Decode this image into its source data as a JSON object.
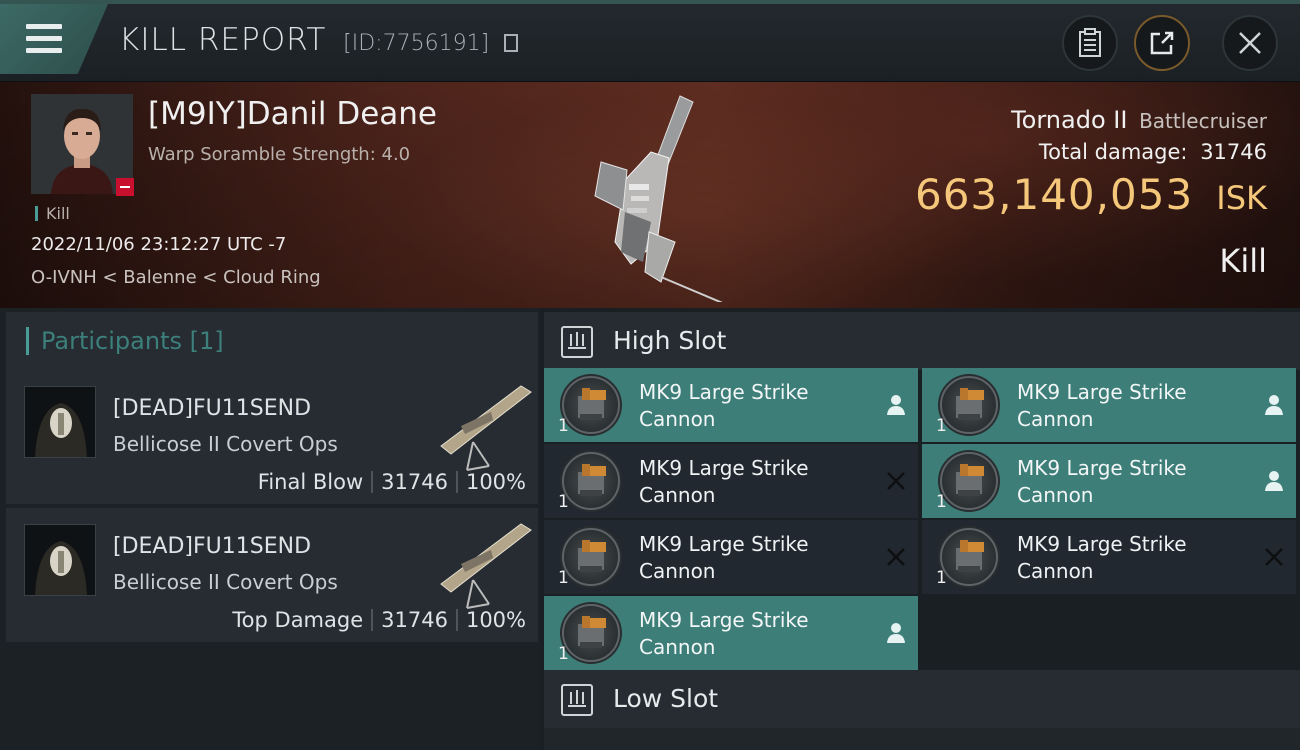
{
  "window": {
    "title": "KILL REPORT",
    "report_id": "[ID:7756191]"
  },
  "victim": {
    "name": "[M9IY]Danil Deane",
    "warp_scramble": "Warp Soramble Strength: 4.0",
    "tag": "Kill",
    "datetime": "2022/11/06 23:12:27 UTC -7",
    "location": "O-IVNH < Balenne < Cloud Ring"
  },
  "ship": {
    "name": "Tornado II",
    "class": "Battlecruiser",
    "total_damage_label": "Total damage:",
    "total_damage": "31746",
    "isk_value": "663,140,053",
    "isk_unit": "ISK",
    "result": "Kill"
  },
  "participants": {
    "title": "Participants [1]",
    "rows": [
      {
        "name": "[DEAD]FU11SEND",
        "ship": "Bellicose II Covert Ops",
        "role": "Final Blow",
        "damage": "31746",
        "percent": "100%"
      },
      {
        "name": "[DEAD]FU11SEND",
        "ship": "Bellicose II Covert Ops",
        "role": "Top Damage",
        "damage": "31746",
        "percent": "100%"
      }
    ]
  },
  "slots": {
    "high_title": "High Slot",
    "low_title": "Low Slot",
    "high_modules": [
      {
        "name": "MK9 Large Strike Cannon",
        "qty": "1",
        "state": "dropped"
      },
      {
        "name": "MK9 Large Strike Cannon",
        "qty": "1",
        "state": "dropped"
      },
      {
        "name": "MK9 Large Strike Cannon",
        "qty": "1",
        "state": "destroyed"
      },
      {
        "name": "MK9 Large Strike Cannon",
        "qty": "1",
        "state": "dropped"
      },
      {
        "name": "MK9 Large Strike Cannon",
        "qty": "1",
        "state": "destroyed"
      },
      {
        "name": "MK9 Large Strike Cannon",
        "qty": "1",
        "state": "destroyed"
      },
      {
        "name": "MK9 Large Strike Cannon",
        "qty": "1",
        "state": "dropped"
      }
    ]
  },
  "colors": {
    "accent_teal": "#3e7e79",
    "isk_gold": "#f4c77a",
    "warning_red": "#c8102e"
  }
}
